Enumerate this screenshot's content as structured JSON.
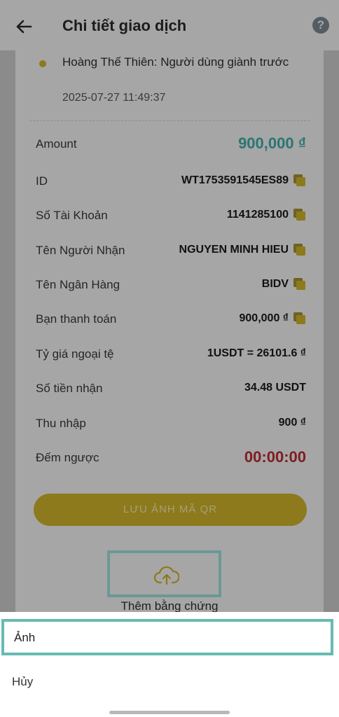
{
  "header": {
    "title": "Chi tiết giao dịch",
    "help_glyph": "?"
  },
  "status": {
    "text": "Hoàng Thế Thiên: Người dùng giành trước",
    "time": "2025-07-27 11:49:37"
  },
  "details": {
    "amount": {
      "label": "Amount",
      "value": "900,000 ₫"
    },
    "id": {
      "label": "ID",
      "value": "WT1753591545ES89"
    },
    "account": {
      "label": "Số Tài Khoản",
      "value": "1141285100"
    },
    "recipient": {
      "label": "Tên Người Nhận",
      "value": "NGUYEN MINH HIEU"
    },
    "bank": {
      "label": "Tên Ngân Hàng",
      "value": "BIDV"
    },
    "paid": {
      "label": "Bạn thanh toán",
      "value": "900,000 ₫"
    },
    "rate": {
      "label": "Tỷ giá ngoại tệ",
      "value": "1USDT = 26101.6 ₫"
    },
    "received": {
      "label": "Số tiền nhận",
      "value": "34.48 USDT"
    },
    "income": {
      "label": "Thu nhập",
      "value": "900 ₫"
    },
    "countdown": {
      "label": "Đếm ngược",
      "value": "00:00:00"
    }
  },
  "actions": {
    "save_qr": "LƯU ẢNH MÃ QR",
    "add_evidence": "Thêm bằng chứng"
  },
  "sheet": {
    "photo": "Ảnh",
    "cancel": "Hủy"
  },
  "colors": {
    "accent_gold": "#E6C62F",
    "amount_teal": "#45B0A8",
    "countdown_red": "#C8303C",
    "highlight": "#67BAB3"
  },
  "icons": [
    "back-arrow-icon",
    "help-icon",
    "copy-icon",
    "cloud-upload-icon"
  ]
}
